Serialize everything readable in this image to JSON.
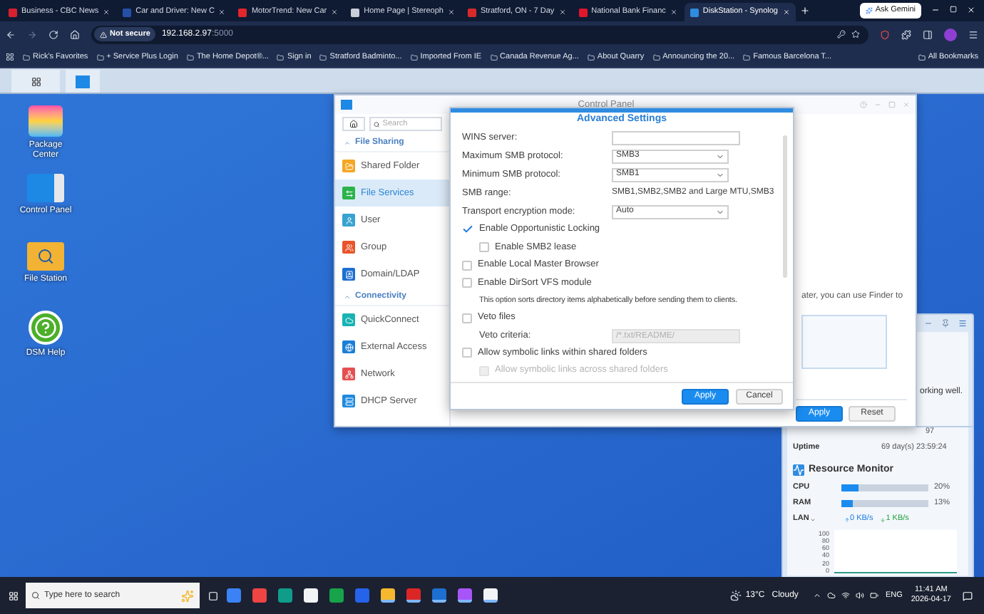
{
  "browser": {
    "tabs": [
      {
        "label": "Business - CBC News",
        "selected": false,
        "color": "#d8202f"
      },
      {
        "label": "Car and Driver: New C",
        "selected": false,
        "color": "#2450a8"
      },
      {
        "label": "MotorTrend: New Car",
        "selected": false,
        "color": "#e3262b"
      },
      {
        "label": "Home Page | Stereoph",
        "selected": false,
        "color": "#c9ced8"
      },
      {
        "label": "Stratford, ON - 7 Day",
        "selected": false,
        "color": "#d82a2a"
      },
      {
        "label": "National Bank Financ",
        "selected": false,
        "color": "#e0162b"
      },
      {
        "label": "DiskStation - Synolog",
        "selected": true,
        "color": "#2f8ce0"
      }
    ],
    "gemini_button": "Ask Gemini",
    "address": {
      "security": "Not secure",
      "url": "192.168.2.97",
      "port": ":5000"
    },
    "bookmarks": [
      "Rick's Favorites",
      "+ Service Plus Login",
      "The Home Depot®...",
      "Sign in",
      "Stratford Badminto...",
      "Imported From IE",
      "Canada Revenue Ag...",
      "About Quarry",
      "Announcing the 20...",
      "Famous Barcelona T..."
    ],
    "all_bookmarks": "All Bookmarks"
  },
  "desktop_icons": [
    {
      "label": "Package Center",
      "kind": "package"
    },
    {
      "label": "Control Panel",
      "kind": "panel"
    },
    {
      "label": "File Station",
      "kind": "folder"
    },
    {
      "label": "DSM Help",
      "kind": "help"
    }
  ],
  "control_panel": {
    "title": "Control Panel",
    "search": {
      "placeholder": "Search"
    },
    "groups": [
      {
        "label": "File Sharing",
        "expanded": true,
        "items": [
          {
            "label": "Shared Folder",
            "selected": false
          },
          {
            "label": "File Services",
            "selected": true
          },
          {
            "label": "User",
            "selected": false
          },
          {
            "label": "Group",
            "selected": false
          },
          {
            "label": "Domain/LDAP",
            "selected": false
          }
        ]
      },
      {
        "label": "Connectivity",
        "expanded": true,
        "items": [
          {
            "label": "QuickConnect",
            "selected": false
          },
          {
            "label": "External Access",
            "selected": false
          },
          {
            "label": "Network",
            "selected": false
          },
          {
            "label": "DHCP Server",
            "selected": false
          }
        ]
      }
    ],
    "content_text": "ater, you can use Finder to",
    "buttons": [
      {
        "label": "Apply",
        "kind": "primary"
      },
      {
        "label": "Reset",
        "kind": "secondary"
      }
    ]
  },
  "dialog": {
    "title": "Advanced Settings",
    "rows": [
      {
        "kind": "input",
        "label": "WINS server:"
      },
      {
        "kind": "select",
        "label": "Maximum SMB protocol:",
        "value": "SMB3"
      },
      {
        "kind": "select",
        "label": "Minimum SMB protocol:",
        "value": "SMB1"
      },
      {
        "kind": "static",
        "label": "SMB range:",
        "value": "SMB1,SMB2,SMB2 and Large MTU,SMB3"
      },
      {
        "kind": "select",
        "label": "Transport encryption mode:",
        "value": "Auto"
      },
      {
        "kind": "checkbox",
        "label": "Enable Opportunistic Locking",
        "checked": true,
        "disabled": false,
        "children": [
          {
            "kind": "checkbox",
            "label": "Enable SMB2 lease",
            "checked": false,
            "disabled": false
          }
        ]
      },
      {
        "kind": "checkbox",
        "label": "Enable Local Master Browser",
        "checked": false,
        "disabled": false
      },
      {
        "kind": "checkbox",
        "label": "Enable DirSort VFS module",
        "checked": false,
        "disabled": false,
        "children": [
          {
            "kind": "note",
            "label": "This option sorts directory items alphabetically before sending them to clients."
          }
        ]
      },
      {
        "kind": "checkbox",
        "label": "Veto files",
        "checked": false,
        "disabled": false,
        "children": [
          {
            "kind": "input",
            "label": "Veto criteria:",
            "placeholder": "/*.txt/README/",
            "disabled": true
          }
        ]
      },
      {
        "kind": "checkbox",
        "label": "Allow symbolic links within shared folders",
        "checked": false,
        "disabled": false,
        "children": [
          {
            "kind": "checkbox",
            "label": "Allow symbolic links across shared folders",
            "checked": false,
            "disabled": true
          }
        ]
      }
    ],
    "buttons": [
      {
        "label": "Apply",
        "kind": "primary"
      },
      {
        "label": "Cancel",
        "kind": "secondary"
      }
    ]
  },
  "system_health": {
    "status_text": "orking well.",
    "partial_value": "97",
    "uptime": {
      "label": "Uptime",
      "value": "69 day(s) 23:59:24"
    }
  },
  "resource_monitor": {
    "title": "Resource Monitor",
    "meters": [
      {
        "label": "CPU",
        "level": 0.2,
        "reading": "20%"
      },
      {
        "label": "RAM",
        "level": 0.13,
        "reading": "13%"
      }
    ],
    "lan": {
      "label": "LAN",
      "upload": "0 KB/s",
      "download": "1 KB/s"
    },
    "y_axis_labels": [
      "100",
      "80",
      "60",
      "40",
      "20",
      "0"
    ]
  },
  "taskbar": {
    "search": {
      "placeholder": "Type here to search"
    },
    "apps": [
      {
        "color": "#3b82f6",
        "running": false
      },
      {
        "color": "#ef4444",
        "running": false
      },
      {
        "color": "#0f9d8a",
        "running": false
      },
      {
        "color": "#f3f4f6",
        "running": false
      },
      {
        "color": "#16a34a",
        "running": false
      },
      {
        "color": "#2563eb",
        "running": false
      },
      {
        "color": "#f5b82e",
        "running": true
      },
      {
        "color": "#dc2626",
        "running": true
      },
      {
        "color": "#1d6fd1",
        "running": true
      },
      {
        "color": "#a855f7",
        "running": true
      },
      {
        "color": "#f3f4f6",
        "running": true
      }
    ],
    "weather": {
      "temperature": "13°C",
      "condition": "Cloudy"
    },
    "language": "ENG",
    "time": "11:41 AM",
    "date": "2026-04-17"
  }
}
